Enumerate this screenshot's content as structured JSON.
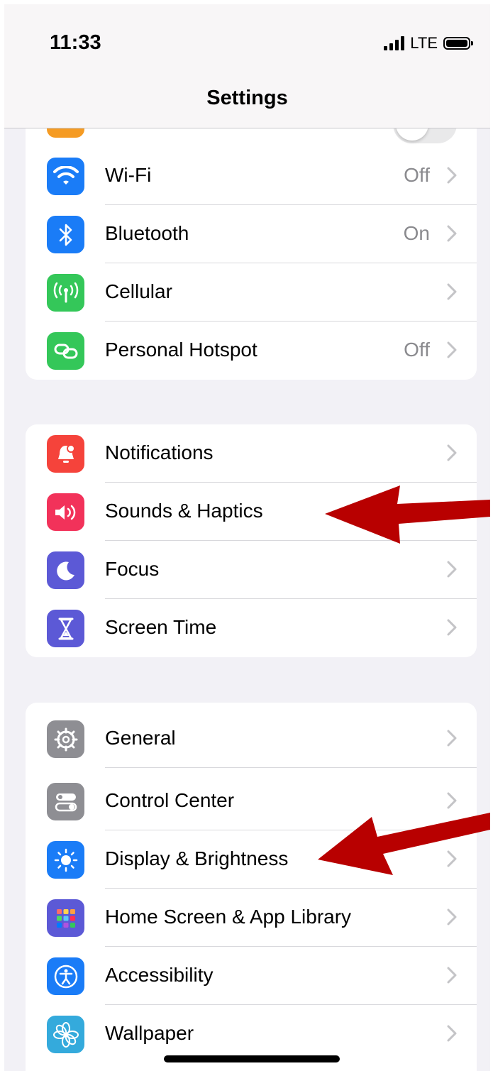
{
  "status_bar": {
    "time": "11:33",
    "network": "LTE"
  },
  "nav": {
    "title": "Settings"
  },
  "group1": [
    {
      "id": "wifi",
      "label": "Wi-Fi",
      "value": "Off",
      "icon": "wifi-icon",
      "color": "#1a7cf7"
    },
    {
      "id": "bluetooth",
      "label": "Bluetooth",
      "value": "On",
      "icon": "bluetooth-icon",
      "color": "#1a7cf7"
    },
    {
      "id": "cellular",
      "label": "Cellular",
      "value": "",
      "icon": "cellular-antenna-icon",
      "color": "#34c759"
    },
    {
      "id": "hotspot",
      "label": "Personal Hotspot",
      "value": "Off",
      "icon": "hotspot-link-icon",
      "color": "#34c759"
    }
  ],
  "group2": [
    {
      "id": "notifications",
      "label": "Notifications",
      "icon": "bell-icon",
      "color": "#f5433b"
    },
    {
      "id": "sounds",
      "label": "Sounds & Haptics",
      "icon": "speaker-icon",
      "color": "#f2325a"
    },
    {
      "id": "focus",
      "label": "Focus",
      "icon": "moon-icon",
      "color": "#5c59d6"
    },
    {
      "id": "screentime",
      "label": "Screen Time",
      "icon": "hourglass-icon",
      "color": "#5c59d6"
    }
  ],
  "group3": [
    {
      "id": "general",
      "label": "General",
      "icon": "gear-icon",
      "color": "#8e8e93"
    },
    {
      "id": "controlcenter",
      "label": "Control Center",
      "icon": "toggles-icon",
      "color": "#8e8e93"
    },
    {
      "id": "display",
      "label": "Display & Brightness",
      "icon": "sun-icon",
      "color": "#1a7cf7"
    },
    {
      "id": "homescreen",
      "label": "Home Screen & App Library",
      "icon": "app-grid-icon",
      "color": "#5c59d6"
    },
    {
      "id": "accessibility",
      "label": "Accessibility",
      "icon": "accessibility-person-icon",
      "color": "#1a7cf7"
    },
    {
      "id": "wallpaper",
      "label": "Wallpaper",
      "icon": "flower-icon",
      "color": "#34aadc"
    }
  ],
  "annotations": {
    "arrow_color": "#b80000"
  }
}
